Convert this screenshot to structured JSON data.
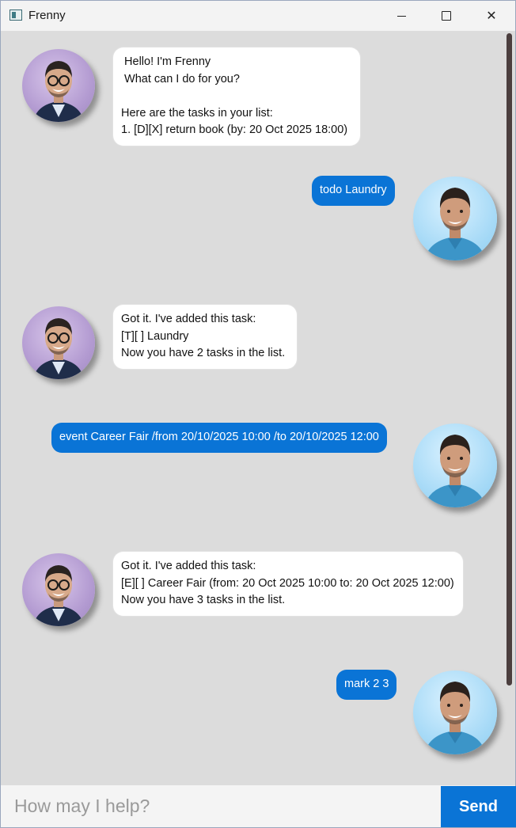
{
  "window": {
    "title": "Frenny",
    "icons": {
      "app": "app-icon",
      "minimize": "minimize-icon",
      "maximize": "maximize-icon",
      "close": "close-icon"
    },
    "close_glyph": "✕"
  },
  "messages": [
    {
      "sender": "bot",
      "lines": [
        " Hello! I'm Frenny",
        " What can I do for you?",
        "",
        "Here are the tasks in your list:",
        "1. [D][X] return book (by: 20 Oct 2025 18:00)"
      ]
    },
    {
      "sender": "user",
      "text": "todo Laundry"
    },
    {
      "sender": "bot",
      "lines": [
        "Got it. I've added this task:",
        "[T][ ] Laundry",
        "Now you have 2 tasks in the list."
      ]
    },
    {
      "sender": "user",
      "text": "event Career Fair /from 20/10/2025 10:00 /to 20/10/2025 12:00"
    },
    {
      "sender": "bot",
      "lines": [
        "Got it. I've added this task:",
        "[E][ ] Career Fair (from: 20 Oct 2025 10:00 to: 20 Oct 2025 12:00)",
        "Now you have 3 tasks in the list."
      ]
    },
    {
      "sender": "user",
      "text": "mark 2 3"
    }
  ],
  "input": {
    "placeholder": "How may I help?",
    "value": ""
  },
  "send_button": {
    "label": "Send"
  },
  "colors": {
    "accent": "#0a74d6",
    "background": "#dcdcdc",
    "bot_bubble": "#ffffff",
    "scrollbar": "#4b3e3e"
  }
}
